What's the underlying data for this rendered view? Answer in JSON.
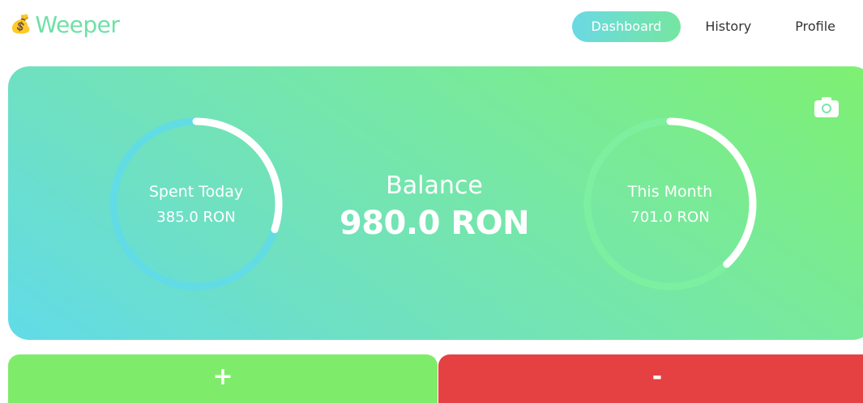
{
  "brand": {
    "icon": "💰",
    "name": "Weeper"
  },
  "nav": {
    "tabs": [
      {
        "label": "Dashboard",
        "active": true
      },
      {
        "label": "History",
        "active": false
      },
      {
        "label": "Profile",
        "active": false
      }
    ]
  },
  "hero": {
    "camera_icon": "camera-icon",
    "spent_today": {
      "label": "Spent Today",
      "value": "385.0 RON",
      "progress": 0.3
    },
    "balance": {
      "label": "Balance",
      "value": "980.0 RON"
    },
    "this_month": {
      "label": "This Month",
      "value": "701.0 RON",
      "progress": 0.38
    }
  },
  "actions": {
    "add_label": "+",
    "subtract_label": "-"
  },
  "colors": {
    "brand": "#6fe0a6",
    "ring_track_left": "#61dbe8",
    "ring_track_right": "#7df0a0",
    "add_button": "#7eec6a",
    "subtract_button": "#e64142"
  }
}
